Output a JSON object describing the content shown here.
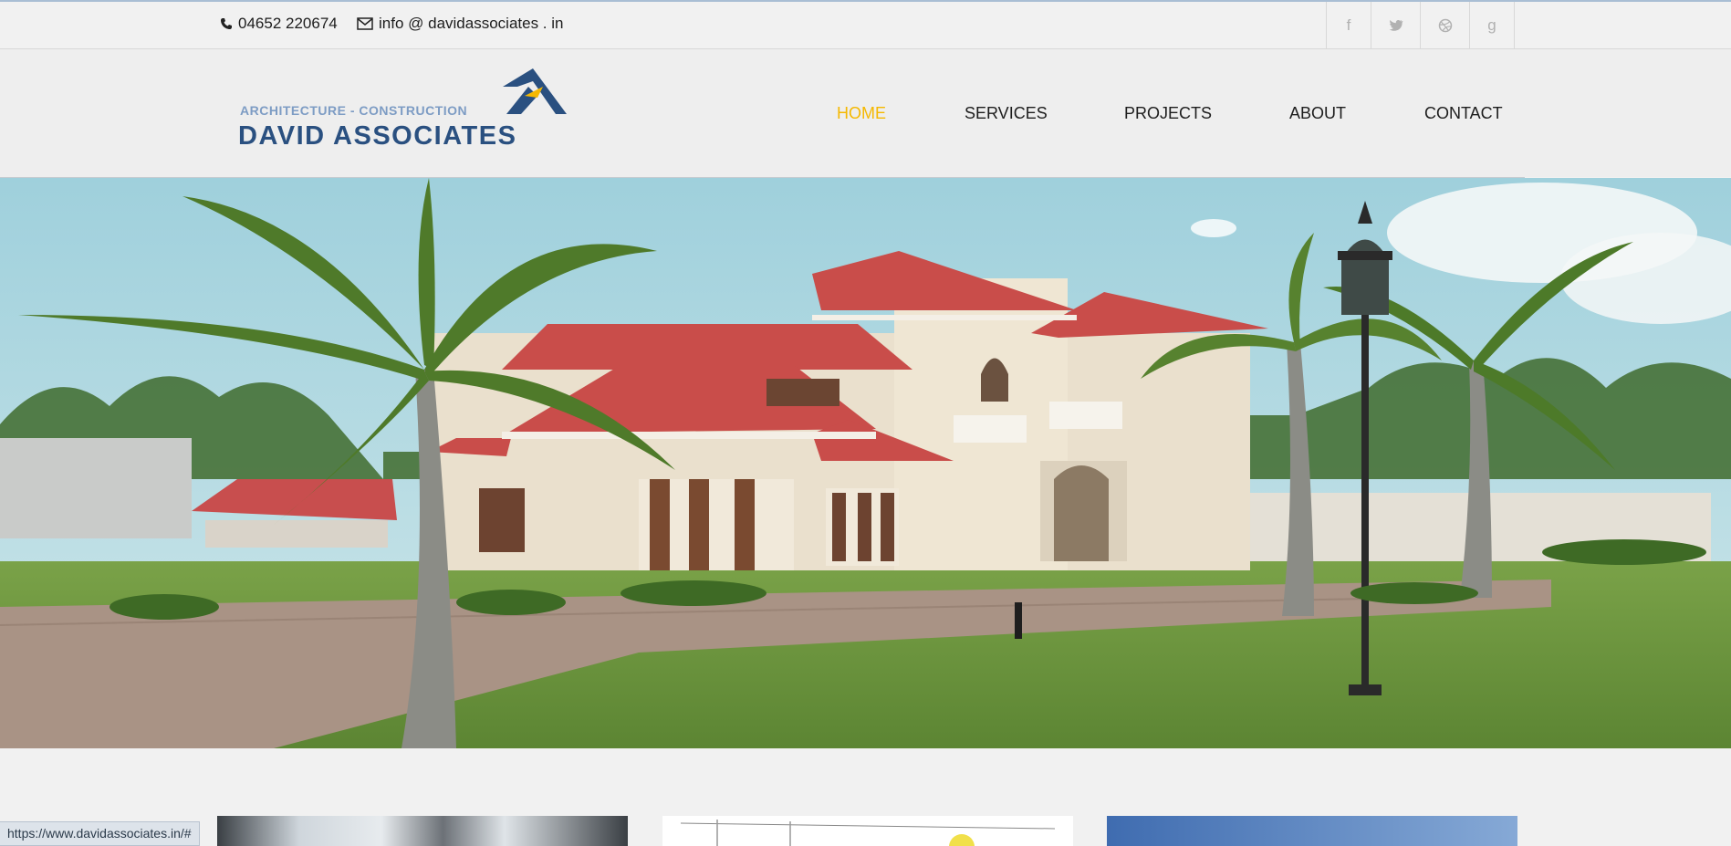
{
  "topbar": {
    "phone": "04652 220674",
    "email": "info @ davidassociates . in",
    "social": [
      {
        "icon": "facebook-icon",
        "glyph": "f"
      },
      {
        "icon": "twitter-icon",
        "glyph": "t"
      },
      {
        "icon": "dribbble-icon",
        "glyph": "◎"
      },
      {
        "icon": "google-plus-icon",
        "glyph": "g"
      }
    ]
  },
  "logo": {
    "tagline": "ARCHITECTURE - CONSTRUCTION",
    "name": "DAVID ASSOCIATES"
  },
  "nav": {
    "items": [
      "HOME",
      "SERVICES",
      "PROJECTS",
      "ABOUT",
      "CONTACT"
    ],
    "active": "HOME"
  },
  "status_bar": {
    "url": "https://www.davidassociates.in/#"
  },
  "colors": {
    "accent": "#f5b800",
    "logo_blue": "#2a5080"
  }
}
